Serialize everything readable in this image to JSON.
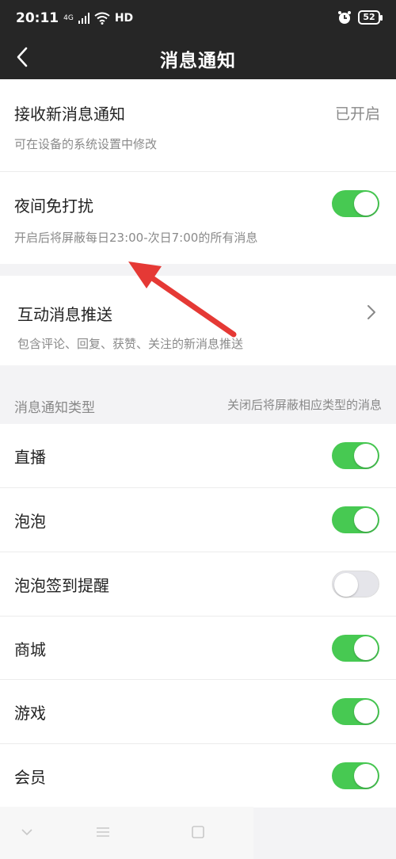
{
  "status_bar": {
    "time": "20:11",
    "network": "4G",
    "hd": "HD",
    "battery": "52"
  },
  "header": {
    "title": "消息通知"
  },
  "notification": {
    "title": "接收新消息通知",
    "status": "已开启",
    "subtitle": "可在设备的系统设置中修改"
  },
  "dnd": {
    "title": "夜间免打扰",
    "subtitle": "开启后将屏蔽每日23:00-次日7:00的所有消息",
    "enabled": true
  },
  "interactive": {
    "title": "互动消息推送",
    "subtitle": "包含评论、回复、获赞、关注的新消息推送"
  },
  "types": {
    "header_left": "消息通知类型",
    "header_right": "关闭后将屏蔽相应类型的消息",
    "items": [
      {
        "label": "直播",
        "enabled": true
      },
      {
        "label": "泡泡",
        "enabled": true
      },
      {
        "label": "泡泡签到提醒",
        "enabled": false
      },
      {
        "label": "商城",
        "enabled": true
      },
      {
        "label": "游戏",
        "enabled": true
      },
      {
        "label": "会员",
        "enabled": true
      }
    ]
  },
  "colors": {
    "toggle_on": "#47c952",
    "header_bg": "#262626",
    "annotation_arrow": "#e53935"
  }
}
